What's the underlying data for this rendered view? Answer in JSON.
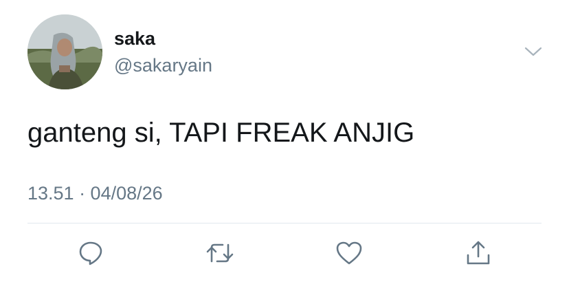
{
  "user": {
    "display_name": "saka",
    "handle": "@sakaryain"
  },
  "tweet": {
    "text": "ganteng si, TAPI FREAK ANJIG",
    "timestamp": "13.51 · 04/08/26"
  },
  "icons": {
    "menu": "chevron-down-icon",
    "reply": "reply-icon",
    "retweet": "retweet-icon",
    "like": "heart-icon",
    "share": "share-icon"
  },
  "colors": {
    "text": "#14171a",
    "secondary": "#657786",
    "divider": "#e1e8ed",
    "icon": "#657786"
  }
}
